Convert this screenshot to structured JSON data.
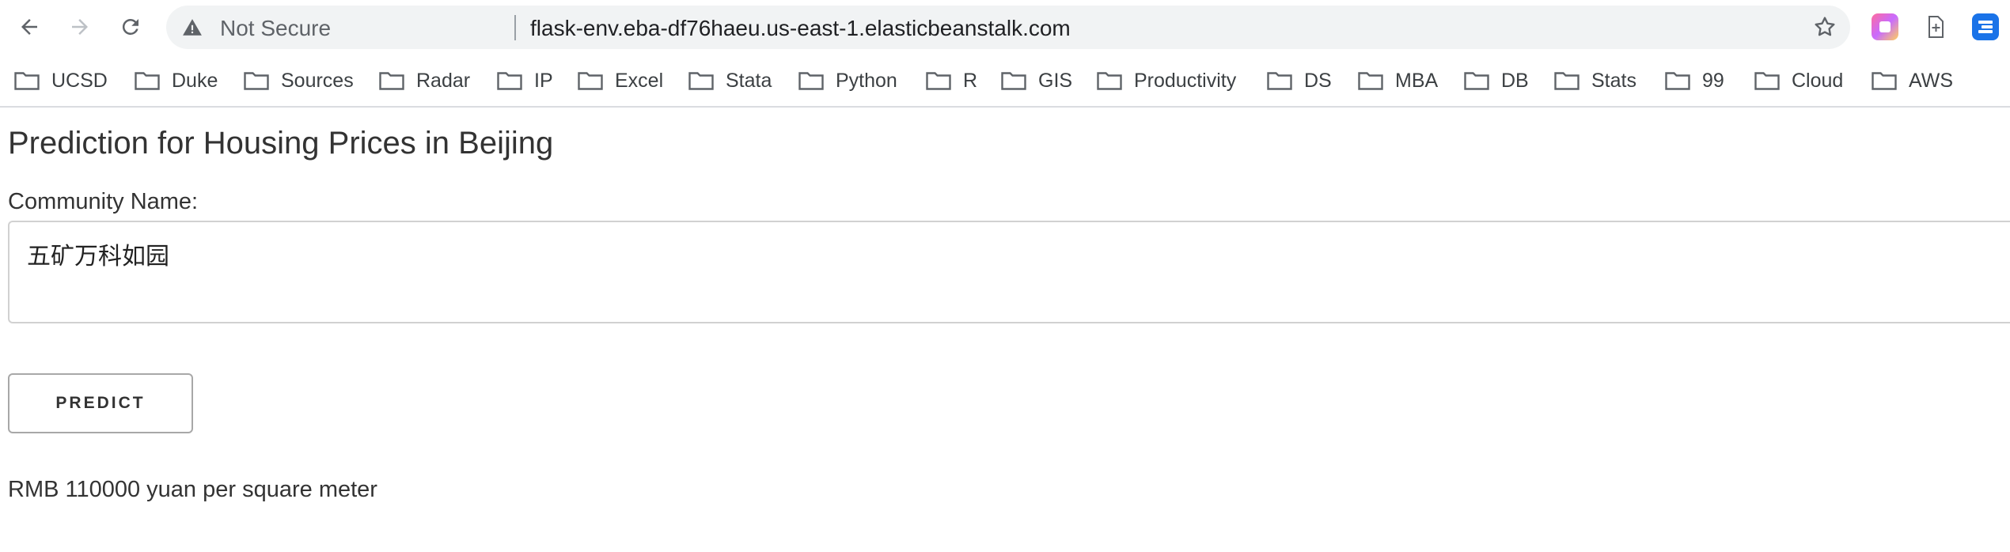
{
  "browser": {
    "security_label": "Not Secure",
    "url": "flask-env.eba-df76haeu.us-east-1.elasticbeanstalk.com",
    "bookmarks": [
      {
        "label": "UCSD"
      },
      {
        "label": "Duke"
      },
      {
        "label": "Sources"
      },
      {
        "label": "Radar"
      },
      {
        "label": "IP"
      },
      {
        "label": "Excel"
      },
      {
        "label": "Stata"
      },
      {
        "label": "Python"
      },
      {
        "label": "R"
      },
      {
        "label": "GIS"
      },
      {
        "label": "Productivity"
      },
      {
        "label": "DS"
      },
      {
        "label": "MBA"
      },
      {
        "label": "DB"
      },
      {
        "label": "Stats"
      },
      {
        "label": "99"
      },
      {
        "label": "Cloud"
      },
      {
        "label": "AWS"
      }
    ]
  },
  "page": {
    "title": "Prediction for Housing Prices in Beijing",
    "field_label": "Community Name:",
    "field_value": "五矿万科如园",
    "predict_label": "PREDICT",
    "result": "RMB 110000 yuan per square meter"
  }
}
